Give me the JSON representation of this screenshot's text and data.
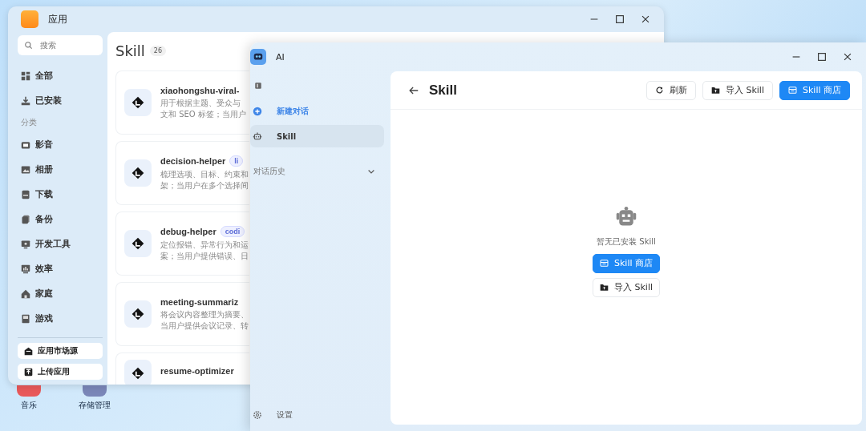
{
  "desktop": {
    "icons": [
      {
        "label": "音乐",
        "color": "#e8585a"
      },
      {
        "label": "存储管理",
        "color": "#7a86b8"
      }
    ]
  },
  "app_store_window": {
    "title": "应用",
    "search": {
      "placeholder": "搜索"
    },
    "nav": [
      {
        "label": "全部"
      },
      {
        "label": "已安装"
      }
    ],
    "category_heading": "分类",
    "categories": [
      {
        "label": "影音"
      },
      {
        "label": "相册"
      },
      {
        "label": "下载"
      },
      {
        "label": "备份"
      },
      {
        "label": "开发工具"
      },
      {
        "label": "效率"
      },
      {
        "label": "家庭"
      },
      {
        "label": "游戏"
      }
    ],
    "footer_buttons": [
      "应用市场源",
      "上传应用"
    ],
    "heading": "Skill",
    "count": "26",
    "skills": [
      {
        "name": "xiaohongshu-viral-",
        "description": [
          "用于根据主题、受众与",
          "文和 SEO 标签；当用户"
        ]
      },
      {
        "name": "decision-helper",
        "tag": "li",
        "description": [
          "梳理选项、目标、约束和",
          "架；当用户在多个选择间"
        ]
      },
      {
        "name": "debug-helper",
        "tag": "codi",
        "description": [
          "定位报错、异常行为和运",
          "案；当用户提供错误、日"
        ]
      },
      {
        "name": "meeting-summariz",
        "description": [
          "将会议内容整理为摘要、",
          "当用户提供会议记录、转"
        ]
      },
      {
        "name": "resume-optimizer"
      }
    ]
  },
  "ai_window": {
    "title": "AI",
    "sidebar": {
      "items": [
        {
          "label": "新建对话",
          "kind": "action",
          "selected": false
        },
        {
          "label": "Skill",
          "kind": "skill",
          "selected": true
        }
      ],
      "history_label": "对话历史",
      "settings": "设置"
    },
    "page": {
      "title": "Skill",
      "buttons": [
        {
          "label": "刷新",
          "kind": "refresh"
        },
        {
          "label": "导入 Skill",
          "kind": "import"
        },
        {
          "label": "Skill 商店",
          "kind": "store"
        }
      ],
      "empty_state": {
        "message": "暂无已安装 Skill",
        "buttons": [
          {
            "label": "Skill 商店",
            "kind": "store"
          },
          {
            "label": "导入 Skill",
            "kind": "import"
          }
        ]
      }
    }
  }
}
